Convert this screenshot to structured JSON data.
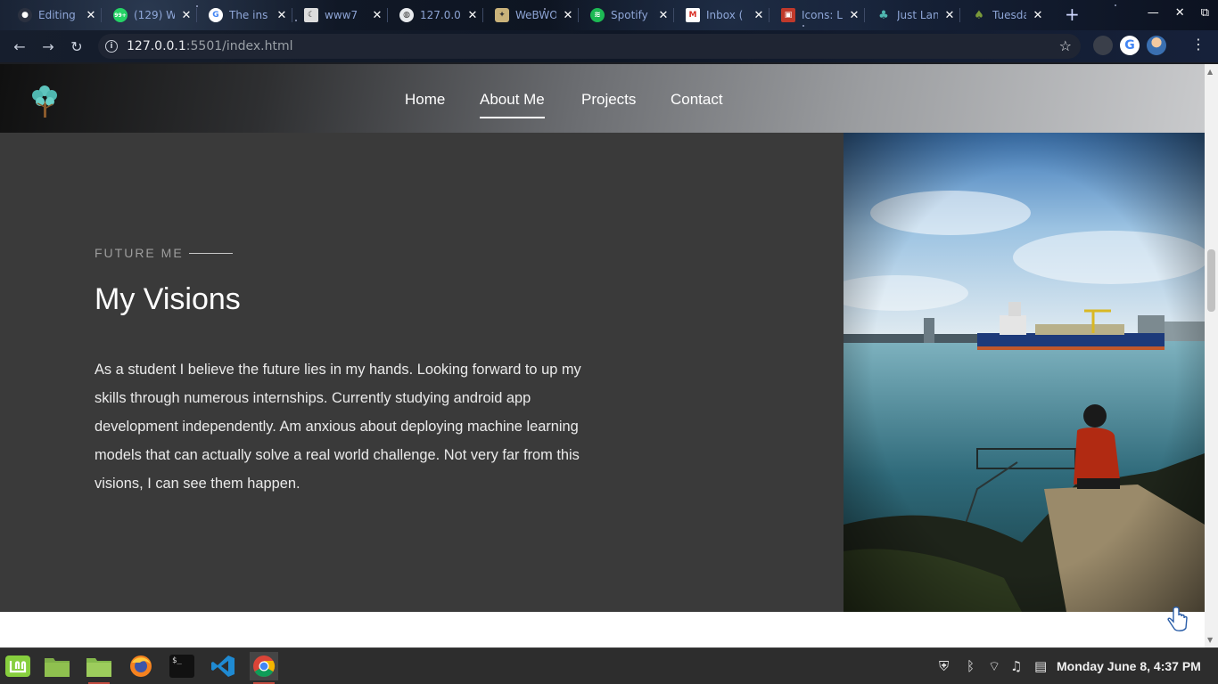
{
  "browser": {
    "tabs": [
      {
        "title": "Editing",
        "icon": "github-icon"
      },
      {
        "title": "(129) W",
        "icon": "whatsapp-icon",
        "badge": "99+"
      },
      {
        "title": "The ins",
        "icon": "google-icon"
      },
      {
        "title": "www7",
        "icon": "moon-icon"
      },
      {
        "title": "127.0.0",
        "icon": "globe-icon"
      },
      {
        "title": "WeBWO",
        "icon": "webwork-icon"
      },
      {
        "title": "Spotify",
        "icon": "spotify-icon"
      },
      {
        "title": "Inbox (",
        "icon": "gmail-icon"
      },
      {
        "title": "Icons: L",
        "icon": "icons-icon"
      },
      {
        "title": "Just Lan",
        "icon": "tree-icon"
      },
      {
        "title": "Tuesda",
        "icon": "plant-icon"
      }
    ],
    "new_tab": "+",
    "close_glyph": "✕",
    "url_host": "127.0.0.1",
    "url_path": ":5501/index.html"
  },
  "site": {
    "nav": [
      {
        "label": "Home",
        "active": false
      },
      {
        "label": "About Me",
        "active": true
      },
      {
        "label": "Projects",
        "active": false
      },
      {
        "label": "Contact",
        "active": false
      }
    ],
    "section": {
      "eyebrow": "FUTURE ME",
      "heading": "My Visions",
      "body": "As a student I believe the future lies in my hands. Looking forward to up my skills through numerous internships. Currently studying android app development independently. Am anxious about deploying machine learning models that can actually solve a real world challenge. Not very far from this visions, I can see them happen."
    },
    "photo_alt": "person sitting by the water looking at a ship"
  },
  "taskbar": {
    "apps": [
      "mint-menu-icon",
      "files-icon",
      "folder-icon",
      "firefox-icon",
      "terminal-icon",
      "vscode-icon",
      "chrome-icon"
    ],
    "clock": "Monday June  8,  4:37 PM"
  },
  "colors": {
    "section_bg": "#3a3a3a",
    "navbar_start": "#101010",
    "navbar_end": "#c9cacc",
    "taskbar": "#2d2d2d"
  }
}
